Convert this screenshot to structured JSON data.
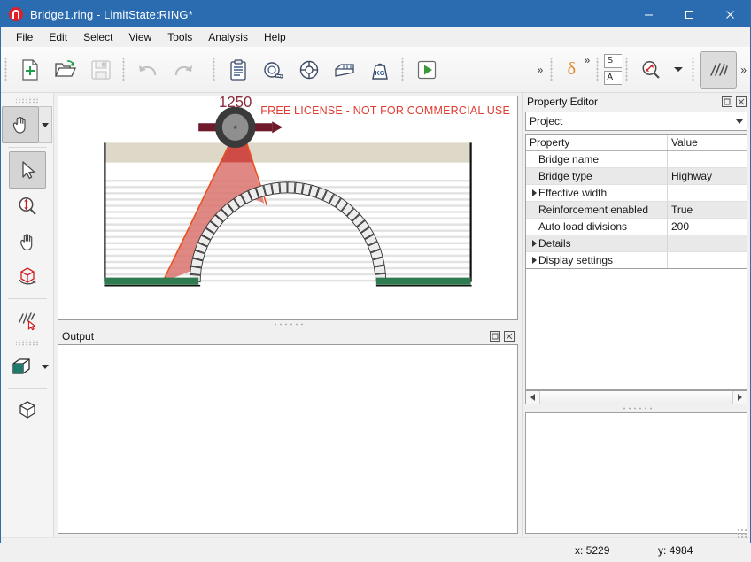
{
  "window": {
    "title": "Bridge1.ring - LimitState:RING*",
    "app_icon": "ring-logo-icon",
    "minimize": "─",
    "maximize": "☐",
    "close": "✕"
  },
  "menubar": {
    "items": [
      {
        "label": "File",
        "mnemonic": "F"
      },
      {
        "label": "Edit",
        "mnemonic": "E"
      },
      {
        "label": "Select",
        "mnemonic": "S"
      },
      {
        "label": "View",
        "mnemonic": "V"
      },
      {
        "label": "Tools",
        "mnemonic": "T"
      },
      {
        "label": "Analysis",
        "mnemonic": "A"
      },
      {
        "label": "Help",
        "mnemonic": "H"
      }
    ]
  },
  "toolbar": {
    "buttons": [
      {
        "name": "new-file-button",
        "icon": "new-file-icon",
        "enabled": true
      },
      {
        "name": "open-file-button",
        "icon": "open-folder-icon",
        "enabled": true
      },
      {
        "name": "save-file-button",
        "icon": "save-disk-icon",
        "enabled": false
      },
      {
        "name": "undo-button",
        "icon": "undo-arrow-icon",
        "enabled": false
      },
      {
        "name": "redo-button",
        "icon": "redo-arrow-icon",
        "enabled": false
      },
      {
        "name": "project-properties-button",
        "icon": "clipboard-icon",
        "enabled": true
      },
      {
        "name": "measure-button",
        "icon": "tape-measure-icon",
        "enabled": true
      },
      {
        "name": "supports-button",
        "icon": "lifebuoy-support-icon",
        "enabled": true
      },
      {
        "name": "backfill-button",
        "icon": "brick-block-icon",
        "enabled": true
      },
      {
        "name": "loads-button",
        "icon": "weight-kg-icon",
        "enabled": true
      },
      {
        "name": "run-analysis-button",
        "icon": "play-run-icon",
        "enabled": true
      }
    ],
    "overflow_chevron": "»",
    "delta_label": "δ",
    "clipped_combo_1": "S",
    "clipped_combo_2": "A",
    "zoom_fit_icon": "zoom-fit-icon",
    "hatch_icon": "hatch-lines-icon"
  },
  "palette": {
    "items": [
      {
        "name": "pan-grab-tool",
        "icon": "grab-hand-icon",
        "active": true,
        "has_dropdown": true
      },
      {
        "name": "select-tool",
        "icon": "arrow-cursor-icon",
        "active": true,
        "has_dropdown": false
      },
      {
        "name": "zoom-tool",
        "icon": "zoom-magnifier-icon",
        "active": false,
        "has_dropdown": false
      },
      {
        "name": "hand-pan-tool",
        "icon": "open-hand-icon",
        "active": false,
        "has_dropdown": false
      },
      {
        "name": "orbit-3d-tool",
        "icon": "rotate-cube-icon",
        "active": false,
        "has_dropdown": false
      },
      {
        "name": "hatch-select-tool",
        "icon": "hatch-cursor-icon",
        "active": false,
        "has_dropdown": false
      },
      {
        "name": "solid-view-tool",
        "icon": "solid-cube-icon",
        "active": false,
        "has_dropdown": true
      },
      {
        "name": "wireframe-view-tool",
        "icon": "wireframe-cube-icon",
        "active": false,
        "has_dropdown": false
      }
    ]
  },
  "canvas": {
    "license_notice": "FREE LICENSE - NOT FOR COMMERCIAL USE",
    "load_label": "1250",
    "colors": {
      "license_red": "#e03c31",
      "surfacing": "#ded8c8",
      "backfill_stripe": "#e4e4e4",
      "arch_block": "#ededed",
      "foundation_green": "#2f7a4f",
      "load_red": "#d9534f",
      "dispersion_orange": "#e8521f",
      "axle_dark_red": "#6e1a2c",
      "wheel_dark": "#3a3a3a"
    }
  },
  "output_panel": {
    "title": "Output",
    "float_icon": "float-window-icon",
    "close_icon": "close-icon",
    "content": ""
  },
  "property_editor": {
    "title": "Property Editor",
    "float_icon": "float-window-icon",
    "close_icon": "close-icon",
    "selector_value": "Project",
    "columns": [
      "Property",
      "Value"
    ],
    "rows": [
      {
        "property": "Bridge name",
        "value": "",
        "expandable": false
      },
      {
        "property": "Bridge type",
        "value": "Highway",
        "expandable": false
      },
      {
        "property": "Effective width",
        "value": "",
        "expandable": true
      },
      {
        "property": "Reinforcement enabled",
        "value": "True",
        "expandable": false
      },
      {
        "property": "Auto load divisions",
        "value": "200",
        "expandable": false
      },
      {
        "property": "Details",
        "value": "",
        "expandable": true
      },
      {
        "property": "Display settings",
        "value": "",
        "expandable": true
      }
    ]
  },
  "statusbar": {
    "x_label": "x: 5229",
    "y_label": "y: 4984"
  }
}
